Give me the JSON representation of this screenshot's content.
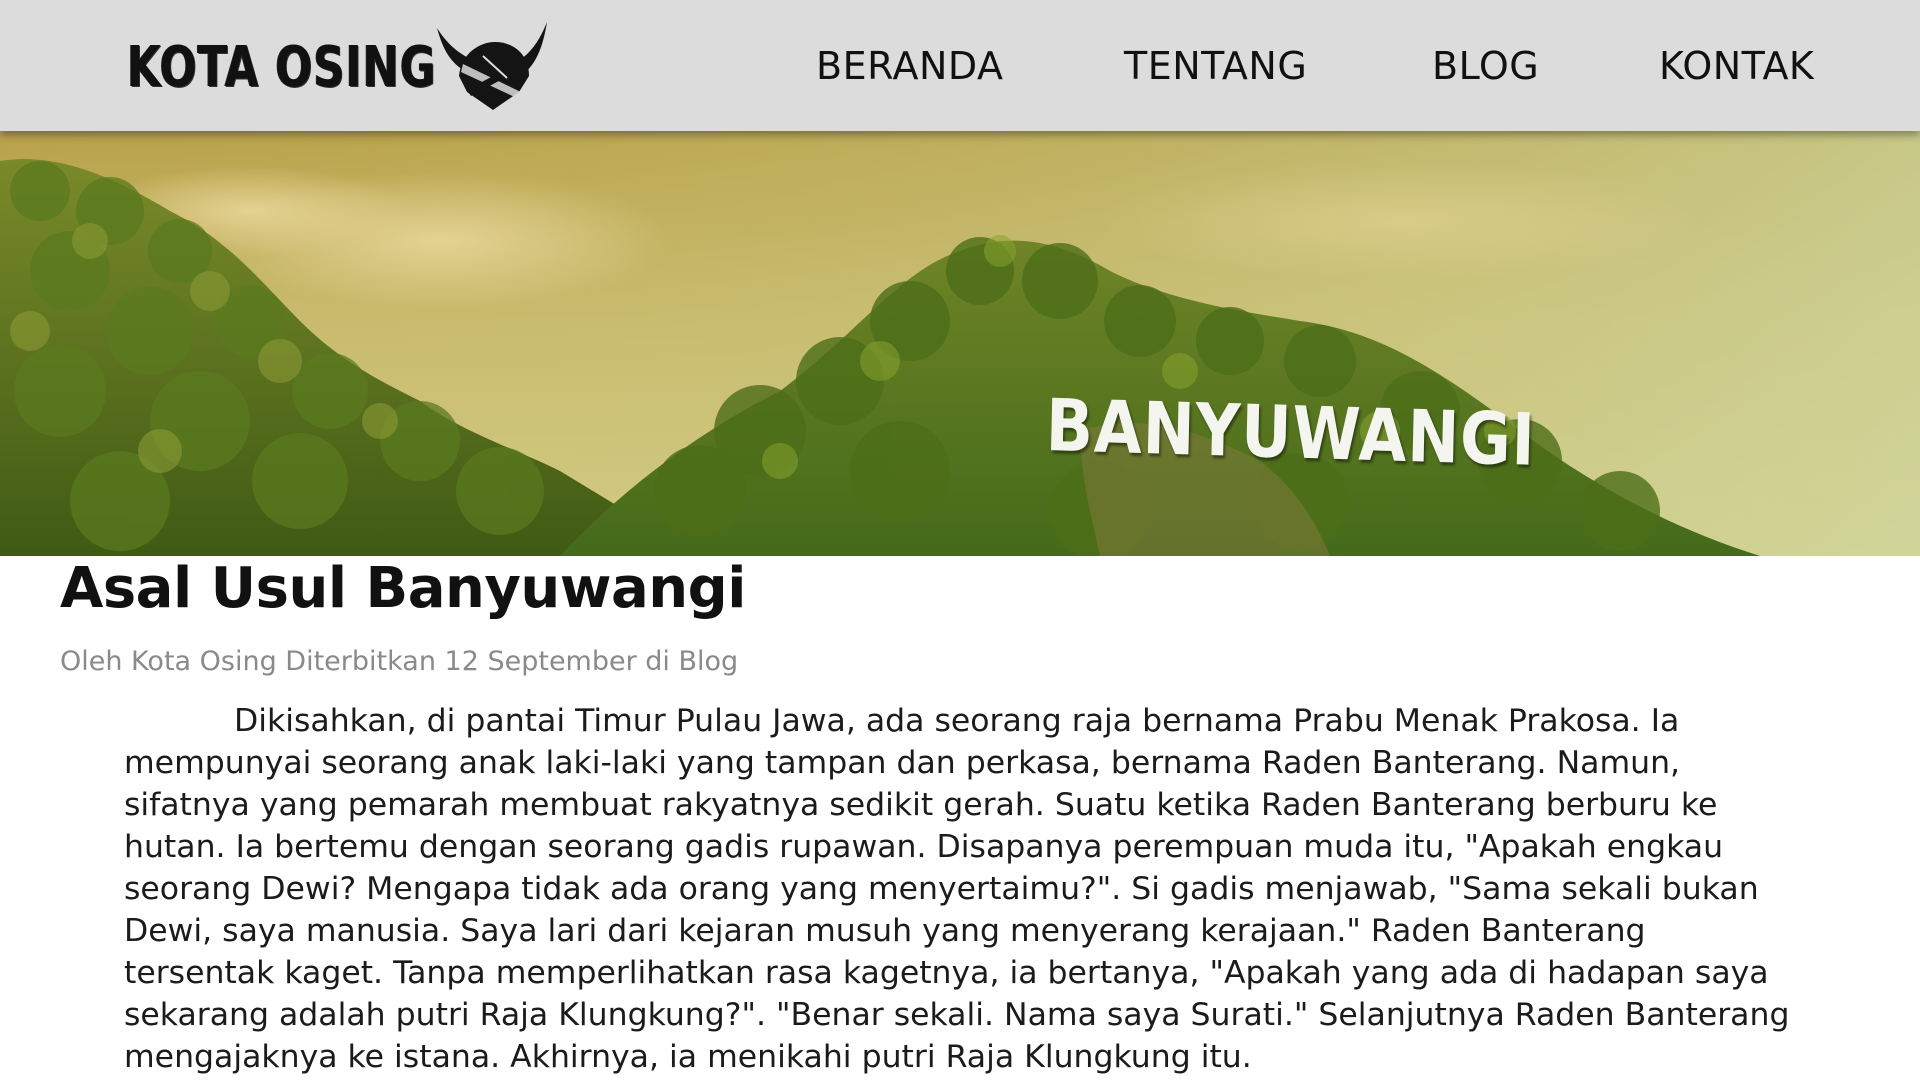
{
  "header": {
    "logo_text": "KOTA OSING",
    "logo_icon": "horned-helmet-emblem",
    "nav": [
      "BERANDA",
      "TENTANG",
      "BLOG",
      "KONTAK"
    ]
  },
  "hero": {
    "sign_text": "BANYUWANGI"
  },
  "article": {
    "title": "Asal Usul Banyuwangi",
    "meta": "Oleh Kota Osing Diterbitkan 12 September di Blog",
    "body": "Dikisahkan, di pantai Timur Pulau Jawa, ada seorang raja bernama Prabu Menak Prakosa. Ia mempunyai seorang anak laki-laki yang tampan dan perkasa, bernama Raden Banterang. Namun, sifatnya yang pemarah membuat rakyatnya sedikit gerah. Suatu ketika Raden Banterang berburu ke hutan. Ia bertemu dengan seorang gadis rupawan. Disapanya perempuan muda itu, \"Apakah engkau seorang Dewi? Mengapa tidak ada orang yang menyertaimu?\". Si gadis menjawab, \"Sama sekali bukan Dewi, saya manusia. Saya lari dari kejaran musuh yang menyerang kerajaan.\" Raden Banterang tersentak kaget. Tanpa memperlihatkan rasa kagetnya, ia bertanya, \"Apakah yang ada di hadapan saya sekarang adalah putri Raja Klungkung?\". \"Benar sekali. Nama saya Surati.\" Selanjutnya Raden Banterang mengajaknya ke istana. Akhirnya, ia menikahi putri Raja Klungkung itu."
  },
  "colors": {
    "header_bg": "#dcdcdc",
    "text": "#111111",
    "meta_text": "#8a8a8a"
  }
}
